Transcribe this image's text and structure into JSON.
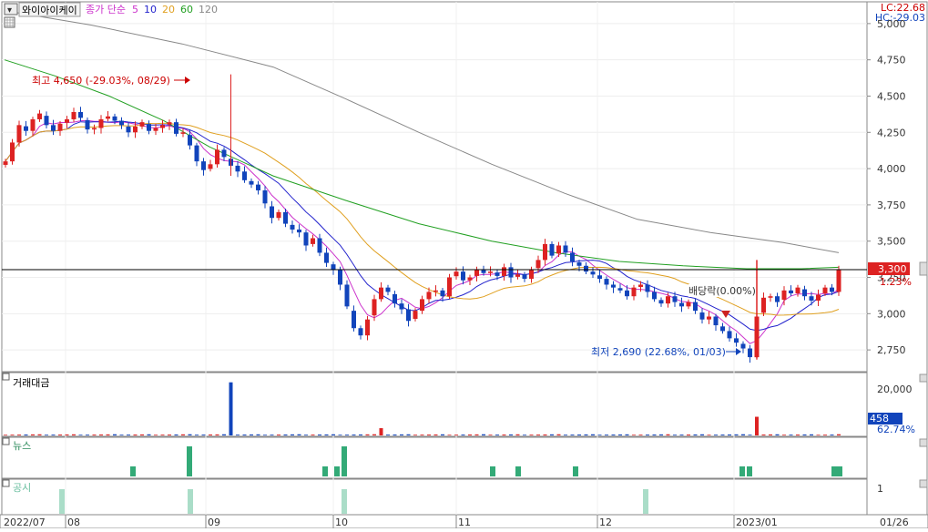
{
  "header": {
    "stock_name": "와이아이케이",
    "ma_prefix": "종가 단순",
    "ma_periods": [
      {
        "label": "5",
        "color": "#cc33cc"
      },
      {
        "label": "10",
        "color": "#2222cc"
      },
      {
        "label": "20",
        "color": "#e0a020"
      },
      {
        "label": "60",
        "color": "#22a022"
      },
      {
        "label": "120",
        "color": "#888888"
      }
    ],
    "lc": "LC:22.68",
    "hc": "HC:-29.03"
  },
  "price_axis": {
    "ticks": [
      "5,000",
      "4,750",
      "4,500",
      "4,250",
      "4,000",
      "3,750",
      "3,500",
      "3,250",
      "3,000",
      "2,750"
    ],
    "current_price": "3,300",
    "current_pct": "1.23%"
  },
  "annotations": {
    "high": "최고 4,650 (-29.03%, 08/29)",
    "low": "최저 2,690 (22.68%, 01/03)",
    "dividend": "배당락(0.00%)"
  },
  "volume_panel": {
    "title": "거래대금",
    "tick": "20,000",
    "current_value": "458",
    "current_pct": "62.74%"
  },
  "news_panel": {
    "title": "뉴스"
  },
  "disclosure_panel": {
    "title": "공시",
    "tick": "1"
  },
  "date_axis": {
    "labels": [
      "2022/07",
      "08",
      "09",
      "10",
      "11",
      "12",
      "2023/01"
    ],
    "right_label": "01/26"
  },
  "colors": {
    "up": "#dd2222",
    "down": "#1144bb",
    "news": "#33aa77",
    "disclosure": "#aaddc8",
    "accent": "#cc0000"
  },
  "chart_data": {
    "type": "candlestick",
    "price_range": [
      2600,
      5150
    ],
    "current_price": 3300,
    "high": {
      "value": 4650,
      "date": "08/29"
    },
    "low": {
      "value": 2690,
      "date": "01/03"
    },
    "volume_range": [
      0,
      22500
    ],
    "volume_spike": 20500,
    "volume_current": 458
  }
}
